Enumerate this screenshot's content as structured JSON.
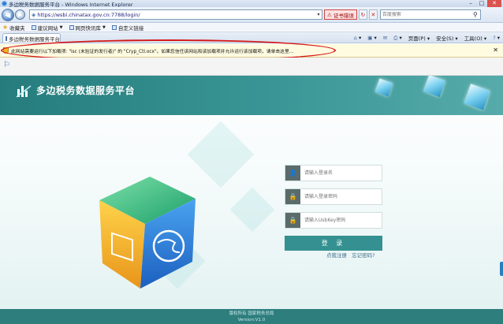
{
  "window": {
    "title": "多边税务数据服务平台 - Windows Internet Explorer",
    "minimize": "–",
    "maximize": "□",
    "close": "✕"
  },
  "nav": {
    "back": "◀",
    "forward": "▶",
    "url": "https://wsbi.chinatax.gov.cn:7788/login/",
    "cert_error": "证书错误",
    "search_placeholder": "百度搜索"
  },
  "favorites": {
    "label": "收藏夹",
    "items": [
      "建议网站",
      "网页快讯库",
      "自定义链接"
    ]
  },
  "tabs": [
    {
      "label": "多边税务数据服务平台"
    }
  ],
  "commands": [
    "页面(P)",
    "安全(S)",
    "工具(O)"
  ],
  "infobar": {
    "message": "此网站需要运行以下加载项: \"isc (未验证的发行者)\" 的 \"Cryp_Ctl.ocx\"。如果您信任该网站和该加载项并允许运行该加载项，请单击这里...",
    "close": "✕"
  },
  "page": {
    "brand": "多边税务数据服务平台",
    "login": {
      "username_placeholder": "请输入登录名",
      "password_placeholder": "请输入登录密码",
      "ukey_placeholder": "请输入UsbKey密码",
      "submit": "登 录",
      "register": "点我注册",
      "forgot": "忘记密码?"
    },
    "footer": {
      "line1": "版权所有 国家税务总局",
      "line2": "Version:V1.0"
    }
  }
}
